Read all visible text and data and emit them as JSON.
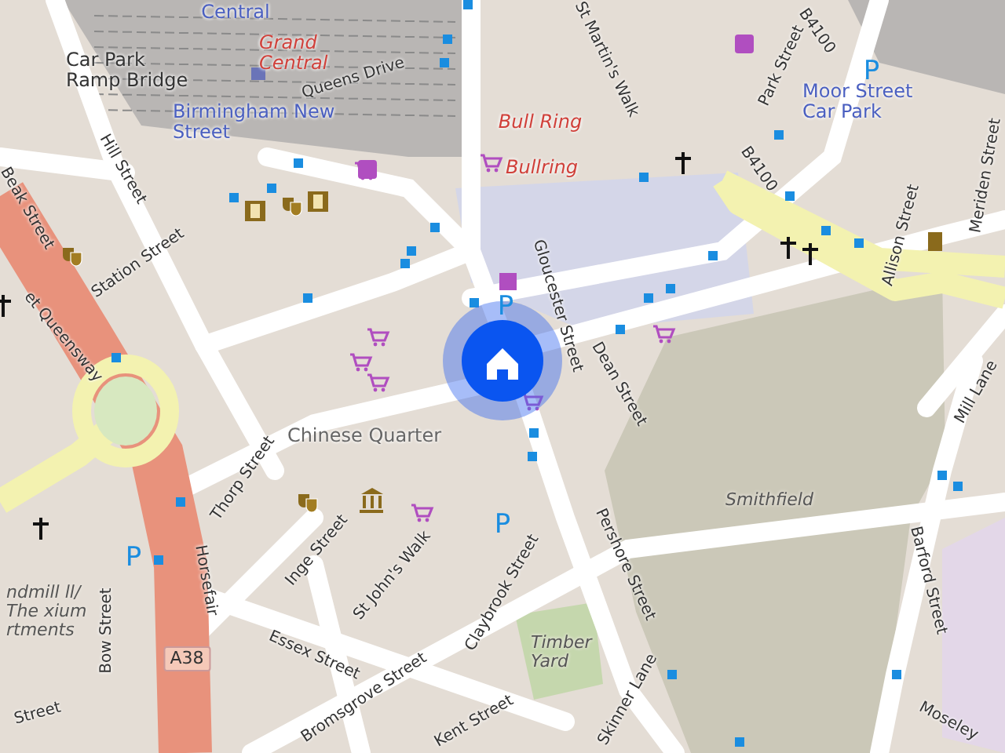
{
  "map": {
    "labels": [
      {
        "text": "Central",
        "kind": "station"
      },
      {
        "text": "Grand Central",
        "kind": "shop"
      },
      {
        "text": "Car Park Ramp Bridge",
        "kind": "place"
      },
      {
        "text": "Birmingham New Street",
        "kind": "station"
      },
      {
        "text": "Queens Drive",
        "kind": "street"
      },
      {
        "text": "Hill Street",
        "kind": "street"
      },
      {
        "text": "Beak Street",
        "kind": "street"
      },
      {
        "text": "Station Street",
        "kind": "street"
      },
      {
        "text": "et Queensway",
        "kind": "street"
      },
      {
        "text": "St Martin's Walk",
        "kind": "street"
      },
      {
        "text": "Bull Ring",
        "kind": "shop"
      },
      {
        "text": "Bullring",
        "kind": "shop"
      },
      {
        "text": "B4100",
        "kind": "street"
      },
      {
        "text": "Park Street",
        "kind": "street"
      },
      {
        "text": "Moor Street Car Park",
        "kind": "station"
      },
      {
        "text": "B4100",
        "kind": "street"
      },
      {
        "text": "Allison Street",
        "kind": "street"
      },
      {
        "text": "Meriden Street",
        "kind": "street"
      },
      {
        "text": "Gloucester Street",
        "kind": "street"
      },
      {
        "text": "Dean Street",
        "kind": "street"
      },
      {
        "text": "Mill Lane",
        "kind": "street"
      },
      {
        "text": "Chinese Quarter",
        "kind": "district"
      },
      {
        "text": "Thorp Street",
        "kind": "street"
      },
      {
        "text": "Inge Street",
        "kind": "street"
      },
      {
        "text": "St John's Walk",
        "kind": "street"
      },
      {
        "text": "Horsefair",
        "kind": "street"
      },
      {
        "text": "A38",
        "kind": "ref"
      },
      {
        "text": "Essex Street",
        "kind": "street"
      },
      {
        "text": "Bromsgrove Street",
        "kind": "street"
      },
      {
        "text": "Kent Street",
        "kind": "street"
      },
      {
        "text": "Smithfield",
        "kind": "area"
      },
      {
        "text": "Claybrook Street",
        "kind": "street"
      },
      {
        "text": "Timber Yard",
        "kind": "area"
      },
      {
        "text": "Pershore Street",
        "kind": "street"
      },
      {
        "text": "Skinner Lane",
        "kind": "street"
      },
      {
        "text": "Barford Street",
        "kind": "street"
      },
      {
        "text": "Moseley",
        "kind": "street"
      },
      {
        "text": "ndmill ll/ The xium rtments",
        "kind": "area"
      },
      {
        "text": "Bow Street",
        "kind": "street"
      },
      {
        "text": "Street",
        "kind": "street"
      },
      {
        "text": "P",
        "kind": "parking"
      },
      {
        "text": "P",
        "kind": "parking"
      },
      {
        "text": "P",
        "kind": "parking"
      },
      {
        "text": "P",
        "kind": "parking"
      }
    ],
    "marker": {
      "kind": "home"
    }
  }
}
